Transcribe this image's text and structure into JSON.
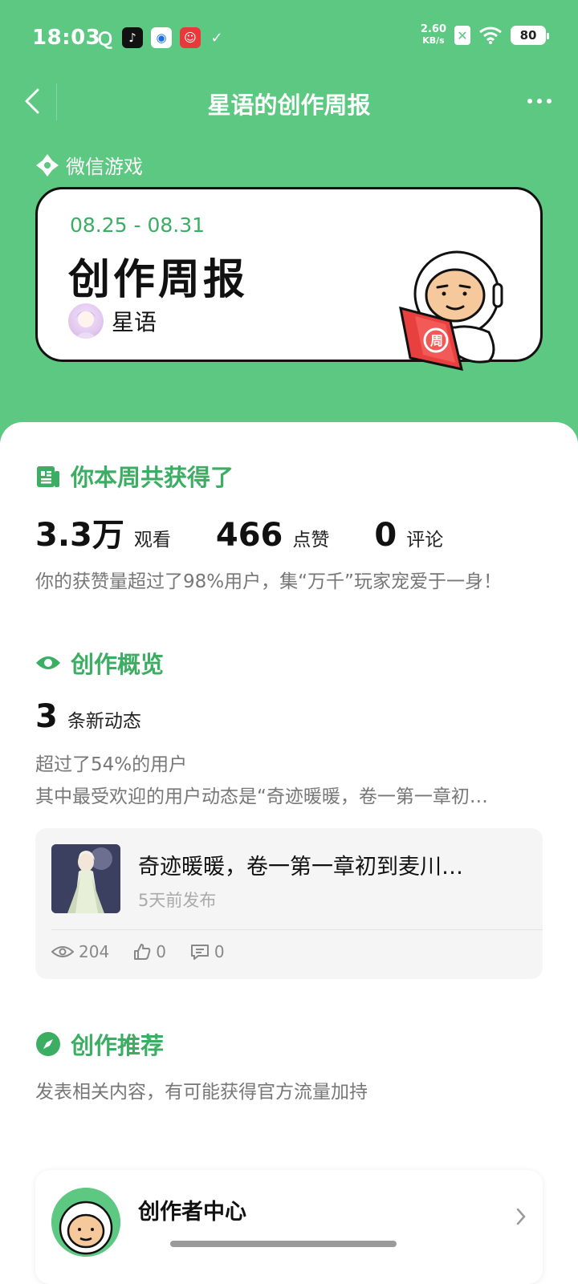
{
  "status_bar": {
    "time": "18:03",
    "net_speed_value": "2.60",
    "net_speed_unit": "KB/s",
    "battery": "80",
    "app_icons": [
      "q-icon",
      "tiktok-icon",
      "blue-app-icon",
      "red-app-icon",
      "check-icon"
    ]
  },
  "nav": {
    "title": "星语的创作周报"
  },
  "brand": {
    "name": "微信游戏"
  },
  "report": {
    "date_range": "08.25 - 08.31",
    "title": "创作周报",
    "author": "星语"
  },
  "weekly": {
    "title": "你本周共获得了",
    "views_value": "3.3万",
    "views_label": "观看",
    "likes_value": "466",
    "likes_label": "点赞",
    "comments_value": "0",
    "comments_label": "评论",
    "summary": "你的获赞量超过了98%用户，集“万千”玩家宠爱于一身！"
  },
  "overview": {
    "title": "创作概览",
    "post_count": "3",
    "post_count_label": "条新动态",
    "percentile_text": "超过了54%的用户",
    "top_post_text": "其中最受欢迎的用户动态是“奇迹暖暖，卷一第一章初…"
  },
  "post": {
    "title": "奇迹暖暖，卷一第一章初到麦川…",
    "time": "5天前发布",
    "views": "204",
    "likes": "0",
    "comments": "0"
  },
  "recommend": {
    "title": "创作推荐",
    "desc": "发表相关内容，有可能获得官方流量加持"
  },
  "creator_center": {
    "title": "创作者中心"
  },
  "colors": {
    "brand_green": "#5cc882",
    "title_green": "#3cae63"
  }
}
